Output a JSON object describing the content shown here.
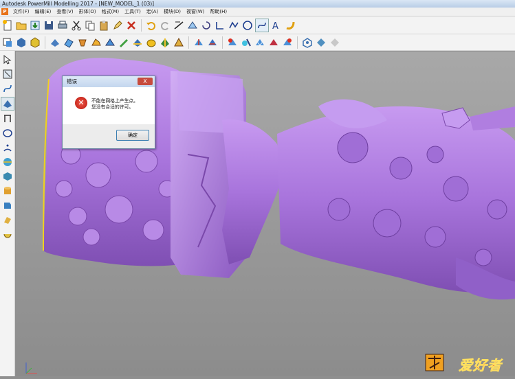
{
  "window": {
    "title": "Autodesk PowerMill Modelling 2017 - [NEW_MODEL_1 (03)]"
  },
  "menu": {
    "logo": "P",
    "items": [
      "文件(F)",
      "编辑(E)",
      "查看(V)",
      "形体(O)",
      "格式(M)",
      "工具(T)",
      "宏(A)",
      "模块(D)",
      "视窗(W)",
      "帮助(H)"
    ]
  },
  "dialog": {
    "title": "错误",
    "close": "X",
    "message_line1": "不能在网格上产生点。",
    "message_line2": "您没有合适的许可。",
    "ok": "确定"
  },
  "watermark": {
    "text": "爱好者"
  },
  "colors": {
    "model": "#b07ee0",
    "model_dark": "#7f4fb3",
    "viewport_top": "#a8a8a8",
    "viewport_bottom": "#8c8c8c"
  }
}
